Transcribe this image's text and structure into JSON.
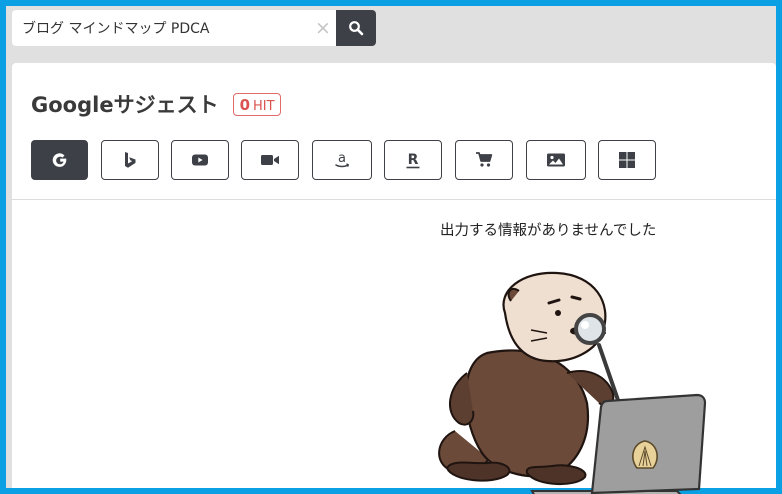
{
  "search": {
    "query": "ブログ マインドマップ PDCA",
    "clear_glyph": "×",
    "clear_icon": "close-icon",
    "submit_icon": "search-icon"
  },
  "panel": {
    "title": "Googleサジェスト",
    "hit_count": "0",
    "hit_label": "HIT"
  },
  "engines": [
    {
      "name": "google",
      "icon": "google-icon",
      "active": true
    },
    {
      "name": "bing",
      "icon": "bing-icon",
      "active": false
    },
    {
      "name": "youtube",
      "icon": "youtube-icon",
      "active": false
    },
    {
      "name": "video",
      "icon": "video-camera-icon",
      "active": false
    },
    {
      "name": "amazon",
      "icon": "amazon-icon",
      "active": false
    },
    {
      "name": "rakuten",
      "icon": "rakuten-icon",
      "active": false
    },
    {
      "name": "shopping",
      "icon": "shopping-cart-icon",
      "active": false
    },
    {
      "name": "images",
      "icon": "image-icon",
      "active": false
    },
    {
      "name": "windows",
      "icon": "windows-icon",
      "active": false
    }
  ],
  "results": {
    "empty_message": "出力する情報がありませんでした"
  },
  "colors": {
    "frame_border": "#0aa0e3",
    "dark_button": "#3d4046",
    "hit_badge": "#d9534f",
    "background": "#e0e0e0"
  }
}
